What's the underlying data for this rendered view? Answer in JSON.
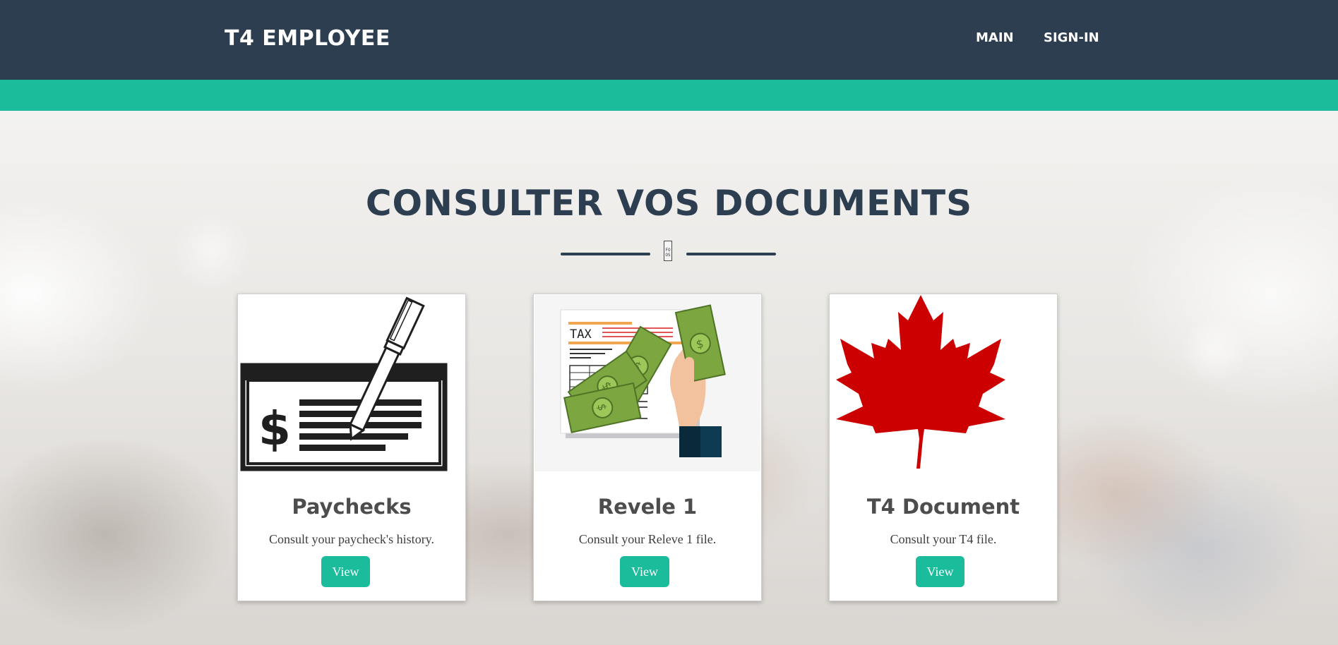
{
  "header": {
    "brand": "T4 EMPLOYEE",
    "nav": [
      {
        "label": "MAIN"
      },
      {
        "label": "SIGN-IN"
      }
    ]
  },
  "main": {
    "title": "CONSULTER VOS DOCUMENTS",
    "divider_icon_text": "FO OS",
    "cards": [
      {
        "title": "Paychecks",
        "description": "Consult your paycheck's history.",
        "button_label": "View",
        "icon": "paycheck-pen-icon"
      },
      {
        "title": "Revele 1",
        "description": "Consult your Releve 1 file.",
        "button_label": "View",
        "icon": "tax-money-icon",
        "image_text": "TAX"
      },
      {
        "title": "T4 Document",
        "description": "Consult your T4 file.",
        "button_label": "View",
        "icon": "maple-leaf-icon"
      }
    ]
  },
  "colors": {
    "navbar": "#2c3e50",
    "accent": "#1abc9c",
    "title": "#2c3e50",
    "maple_leaf": "#cc0000",
    "money": "#7ba640"
  }
}
